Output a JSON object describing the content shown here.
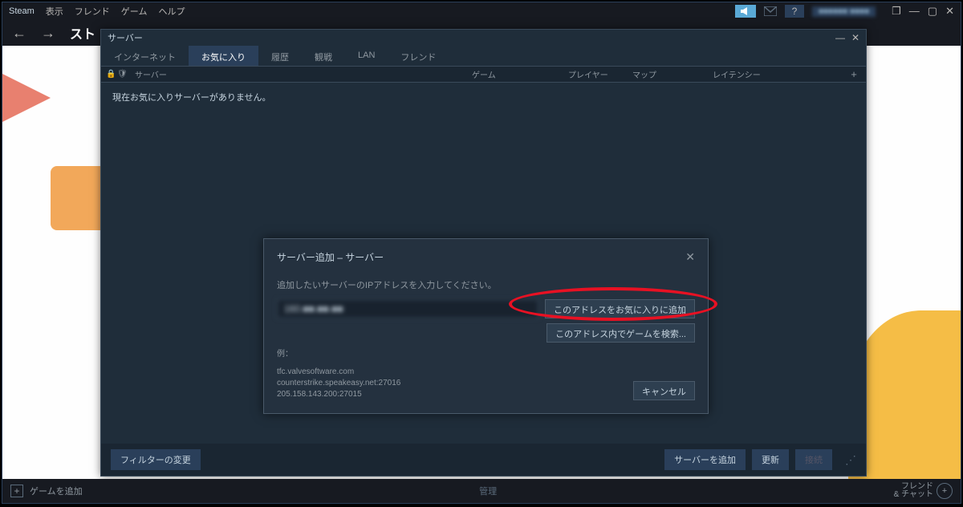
{
  "menubar": {
    "brand": "Steam",
    "items": [
      "表示",
      "フレンド",
      "ゲーム",
      "ヘルプ"
    ],
    "username": "■■■■■■ ■■■■"
  },
  "nav": {
    "title": "スト"
  },
  "server_win": {
    "title": "サーバー",
    "tabs": [
      "インターネット",
      "お気に入り",
      "履歴",
      "観戦",
      "LAN",
      "フレンド"
    ],
    "active_tab": 1,
    "headers": {
      "server": "サーバー",
      "game": "ゲーム",
      "players": "プレイヤー",
      "map": "マップ",
      "latency": "レイテンシー"
    },
    "empty_msg": "現在お気に入りサーバーがありません。",
    "footer": {
      "filter": "フィルターの変更",
      "add": "サーバーを追加",
      "refresh": "更新",
      "connect": "接続"
    }
  },
  "modal": {
    "title": "サーバー追加 – サーバー",
    "sub": "追加したいサーバーのIPアドレスを入力してください。",
    "input_value": "160.■■.■■.■■",
    "btn_add": "このアドレスをお気に入りに追加",
    "btn_search": "このアドレス内でゲームを検索...",
    "btn_cancel": "キャンセル",
    "examples_label": "例：",
    "examples": "tfc.valvesoftware.com\ncounterstrike.speakeasy.net:27016\n205.158.143.200:27015"
  },
  "bottombar": {
    "addgame": "ゲームを追加",
    "mid": "管理",
    "chat": "フレンド\n& チャット"
  }
}
